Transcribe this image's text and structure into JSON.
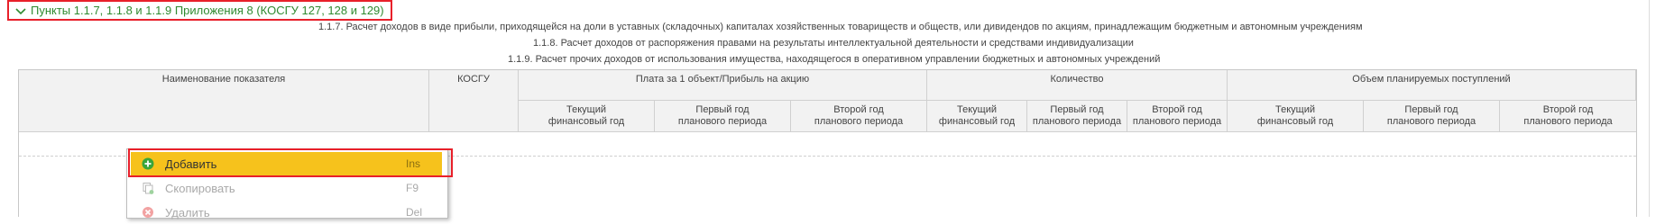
{
  "section": {
    "title": "Пункты 1.1.7, 1.1.8 и 1.1.9 Приложения 8 (КОСГУ 127, 128 и 129)",
    "chevron_icon": "chevron-down-icon",
    "accent_color": "#2f8a2f"
  },
  "captions": [
    "1.1.7. Расчет доходов в виде прибыли, приходящейся на доли в уставных (складочных) капиталах хозяйственных товариществ и обществ, или дивидендов по акциям, принадлежащим бюджетным и автономным учреждениям",
    "1.1.8. Расчет доходов от распоряжения правами на результаты интеллектуальной деятельности и средствами индивидуализации",
    "1.1.9. Расчет  прочих доходов от использования имущества, находящегося в оперативном управлении бюджетных и автономных учреждений"
  ],
  "table": {
    "col_name": "Наименование показателя",
    "col_kosgu": "КОСГУ",
    "group_payment": "Плата за 1 объект/Прибыль на акцию",
    "group_quantity": "Количество",
    "group_volume": "Объем планируемых поступлений",
    "sub": {
      "current": [
        "Текущий",
        "финансовый год"
      ],
      "first": [
        "Первый год",
        "планового периода"
      ],
      "second": [
        "Второй год",
        "планового периода"
      ]
    }
  },
  "context_menu": {
    "items": [
      {
        "label": "Добавить",
        "shortcut": "Ins",
        "icon": "add-icon",
        "state": "active"
      },
      {
        "label": "Скопировать",
        "shortcut": "F9",
        "icon": "copy-icon",
        "state": "disabled"
      },
      {
        "label": "Удалить",
        "shortcut": "Del",
        "icon": "delete-icon",
        "state": "disabled"
      }
    ],
    "active_color": "#f6c21c"
  }
}
